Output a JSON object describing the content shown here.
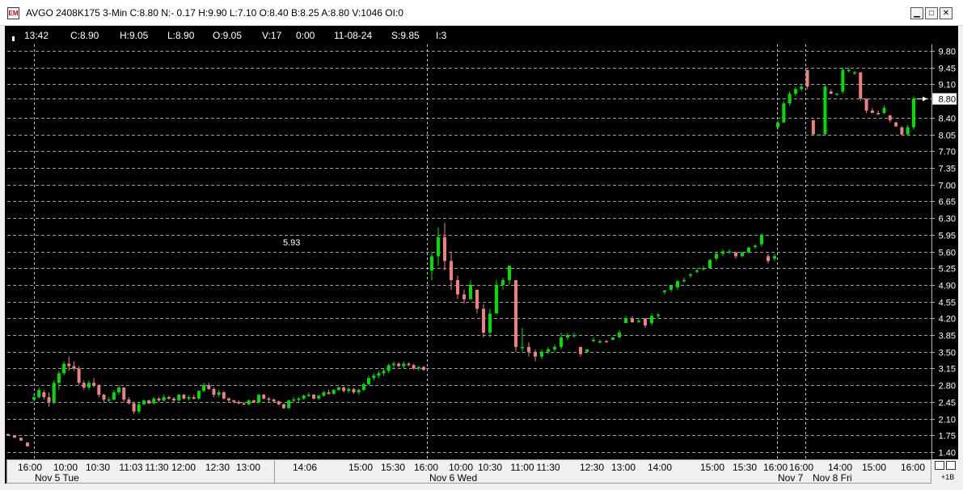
{
  "window": {
    "title": "AVGO 2408K175 3-Min C:8.80 N:- 0.17 H:9.90 L:7.10 O:8.40 B:8.25 A:8.80 V:1046 OI:0",
    "icon": "chart-app-icon",
    "buttons": {
      "minimize": "▁",
      "maximize": "□",
      "close": "✕"
    }
  },
  "infobar": {
    "time": "13:42",
    "close": "C:8.90",
    "high": "H:9.05",
    "low": "L:8.90",
    "open": "O:9.05",
    "volume": "V:17",
    "v2": "0:00",
    "date": "11-08-24",
    "s": "S:9.85",
    "i": "I:3"
  },
  "annotation_label": "5.93",
  "current_price_label": "8.80",
  "corner_label": "+1B",
  "colors": {
    "up": "#00e000",
    "down": "#f08080",
    "grid": "#a0a0a0",
    "background": "#000000"
  },
  "chart_data": {
    "type": "candlestick",
    "ylim": [
      1.4,
      9.8
    ],
    "y_ticks": [
      "9.80",
      "9.45",
      "9.10",
      "8.80",
      "8.40",
      "8.05",
      "7.70",
      "7.35",
      "7.00",
      "6.65",
      "6.30",
      "5.95",
      "5.60",
      "5.25",
      "4.90",
      "4.55",
      "4.20",
      "3.85",
      "3.50",
      "3.15",
      "2.80",
      "2.45",
      "2.10",
      "1.75",
      "1.40"
    ],
    "grid": true,
    "x_ticks": [
      "16:00",
      "10:00",
      "10:30",
      "11:03",
      "11:30",
      "12:00",
      "12:30",
      "13:00",
      "14:06",
      "15:00",
      "15:30",
      "16:00",
      "10:00",
      "10:30",
      "11:00",
      "11:30",
      "12:30",
      "13:00",
      "14:00",
      "15:00",
      "15:30",
      "16:00",
      "16:00",
      "14:00",
      "15:00",
      "16:00"
    ],
    "date_labels": [
      "Nov 5 Tue",
      "Nov 6 Wed",
      "Nov 7",
      "Nov 8 Fri"
    ],
    "series": [
      {
        "values": [
          [
            1.78,
            1.78,
            1.74,
            1.74
          ],
          [
            1.74,
            1.74,
            1.7,
            1.7
          ],
          [
            1.7,
            1.7,
            1.64,
            1.64
          ],
          [
            1.6,
            1.6,
            1.52,
            1.52
          ]
        ]
      },
      {
        "values": [
          [
            2.5,
            2.62,
            2.45,
            2.55
          ],
          [
            2.55,
            2.75,
            2.52,
            2.7
          ],
          [
            2.65,
            2.7,
            2.5,
            2.55
          ],
          [
            2.55,
            2.65,
            2.35,
            2.45
          ],
          [
            2.45,
            2.9,
            2.4,
            2.85
          ],
          [
            2.85,
            3.1,
            2.7,
            3.05
          ],
          [
            3.05,
            3.3,
            3.0,
            3.25
          ],
          [
            3.25,
            3.4,
            3.1,
            3.2
          ],
          [
            3.2,
            3.3,
            3.1,
            3.15
          ],
          [
            3.15,
            3.2,
            2.8,
            2.85
          ],
          [
            2.85,
            2.9,
            2.7,
            2.75
          ],
          [
            2.75,
            2.9,
            2.7,
            2.85
          ],
          [
            2.85,
            2.95,
            2.75,
            2.8
          ],
          [
            2.8,
            2.82,
            2.55,
            2.6
          ],
          [
            2.6,
            2.62,
            2.45,
            2.5
          ],
          [
            2.5,
            2.55,
            2.45,
            2.5
          ],
          [
            2.5,
            2.7,
            2.48,
            2.65
          ],
          [
            2.65,
            2.8,
            2.6,
            2.75
          ],
          [
            2.75,
            2.75,
            2.45,
            2.5
          ],
          [
            2.5,
            2.55,
            2.4,
            2.42
          ],
          [
            2.42,
            2.45,
            2.2,
            2.25
          ],
          [
            2.25,
            2.45,
            2.2,
            2.4
          ],
          [
            2.4,
            2.5,
            2.38,
            2.48
          ],
          [
            2.48,
            2.5,
            2.4,
            2.42
          ],
          [
            2.42,
            2.55,
            2.4,
            2.52
          ],
          [
            2.52,
            2.55,
            2.45,
            2.48
          ],
          [
            2.48,
            2.6,
            2.45,
            2.55
          ],
          [
            2.55,
            2.58,
            2.5,
            2.52
          ],
          [
            2.52,
            2.55,
            2.45,
            2.48
          ],
          [
            2.48,
            2.62,
            2.46,
            2.6
          ],
          [
            2.6,
            2.62,
            2.5,
            2.52
          ],
          [
            2.52,
            2.58,
            2.48,
            2.55
          ],
          [
            2.55,
            2.6,
            2.5,
            2.52
          ],
          [
            2.52,
            2.7,
            2.5,
            2.68
          ],
          [
            2.68,
            2.85,
            2.65,
            2.8
          ],
          [
            2.8,
            2.85,
            2.7,
            2.72
          ],
          [
            2.72,
            2.75,
            2.55,
            2.6
          ],
          [
            2.6,
            2.7,
            2.55,
            2.65
          ],
          [
            2.65,
            2.68,
            2.5,
            2.52
          ],
          [
            2.52,
            2.55,
            2.45,
            2.48
          ],
          [
            2.48,
            2.5,
            2.42,
            2.45
          ],
          [
            2.45,
            2.48,
            2.4,
            2.42
          ],
          [
            2.42,
            2.45,
            2.38,
            2.4
          ],
          [
            2.4,
            2.5,
            2.38,
            2.48
          ],
          [
            2.48,
            2.5,
            2.42,
            2.44
          ],
          [
            2.44,
            2.62,
            2.42,
            2.6
          ],
          [
            2.6,
            2.62,
            2.5,
            2.52
          ],
          [
            2.52,
            2.55,
            2.45,
            2.5
          ],
          [
            2.5,
            2.52,
            2.44,
            2.46
          ],
          [
            2.46,
            2.48,
            2.38,
            2.4
          ],
          [
            2.4,
            2.42,
            2.3,
            2.32
          ],
          [
            2.32,
            2.5,
            2.3,
            2.48
          ],
          [
            2.48,
            2.55,
            2.45,
            2.5
          ],
          [
            2.5,
            2.55,
            2.45,
            2.52
          ],
          [
            2.52,
            2.6,
            2.5,
            2.58
          ],
          [
            2.58,
            2.65,
            2.55,
            2.6
          ],
          [
            2.6,
            2.62,
            2.5,
            2.52
          ],
          [
            2.52,
            2.6,
            2.5,
            2.58
          ],
          [
            2.58,
            2.68,
            2.56,
            2.65
          ],
          [
            2.65,
            2.7,
            2.6,
            2.62
          ],
          [
            2.62,
            2.72,
            2.6,
            2.7
          ],
          [
            2.7,
            2.78,
            2.68,
            2.75
          ],
          [
            2.75,
            2.78,
            2.65,
            2.68
          ],
          [
            2.68,
            2.75,
            2.64,
            2.72
          ],
          [
            2.72,
            2.74,
            2.62,
            2.65
          ],
          [
            2.65,
            2.72,
            2.6,
            2.7
          ],
          [
            2.7,
            2.85,
            2.68,
            2.82
          ],
          [
            2.82,
            3.0,
            2.8,
            2.95
          ],
          [
            2.95,
            3.05,
            2.9,
            3.0
          ],
          [
            3.0,
            3.1,
            2.95,
            3.05
          ],
          [
            3.05,
            3.15,
            3.0,
            3.1
          ],
          [
            3.1,
            3.25,
            3.05,
            3.22
          ],
          [
            3.22,
            3.3,
            3.15,
            3.25
          ],
          [
            3.25,
            3.28,
            3.18,
            3.2
          ],
          [
            3.2,
            3.3,
            3.15,
            3.25
          ],
          [
            3.25,
            3.28,
            3.2,
            3.22
          ],
          [
            3.22,
            3.25,
            3.12,
            3.15
          ],
          [
            3.15,
            3.2,
            3.1,
            3.18
          ],
          [
            3.18,
            3.2,
            3.1,
            3.12
          ]
        ]
      },
      {
        "values": [
          [
            5.2,
            5.6,
            5.0,
            5.5
          ],
          [
            5.5,
            6.1,
            5.3,
            5.9
          ],
          [
            5.9,
            6.2,
            5.2,
            5.4
          ],
          [
            5.4,
            5.6,
            4.8,
            5.0
          ],
          [
            5.0,
            5.1,
            4.6,
            4.7
          ],
          [
            4.7,
            4.8,
            4.5,
            4.6
          ],
          [
            4.6,
            5.0,
            4.6,
            4.9
          ],
          [
            4.8,
            4.8,
            4.3,
            4.4
          ],
          [
            4.4,
            4.5,
            3.8,
            3.9
          ],
          [
            3.9,
            4.4,
            3.8,
            4.3
          ],
          [
            4.3,
            5.0,
            4.3,
            4.9
          ],
          [
            4.9,
            5.05,
            4.8,
            5.0
          ],
          [
            5.0,
            5.3,
            4.9,
            5.3
          ],
          [
            5.0,
            5.0,
            3.5,
            3.6
          ],
          [
            3.6,
            4.0,
            3.5,
            3.6
          ],
          [
            3.6,
            3.7,
            3.4,
            3.5
          ],
          [
            3.5,
            3.55,
            3.3,
            3.4
          ],
          [
            3.4,
            3.55,
            3.35,
            3.5
          ],
          [
            3.5,
            3.6,
            3.45,
            3.55
          ],
          [
            3.55,
            3.65,
            3.5,
            3.6
          ],
          [
            3.6,
            3.9,
            3.55,
            3.8
          ],
          [
            3.8,
            3.9,
            3.75,
            3.85
          ],
          [
            3.85,
            3.9,
            3.8,
            3.85
          ],
          [
            3.6,
            3.6,
            3.4,
            3.45
          ],
          [
            3.5,
            3.55,
            3.5,
            3.55
          ],
          [
            3.75,
            3.8,
            3.7,
            3.75
          ],
          [
            3.7,
            3.75,
            3.68,
            3.72
          ],
          [
            3.72,
            3.75,
            3.7,
            3.7
          ],
          [
            3.75,
            3.8,
            3.75,
            3.8
          ],
          [
            3.8,
            3.95,
            3.8,
            3.9
          ],
          [
            4.1,
            4.25,
            4.1,
            4.2
          ],
          [
            4.2,
            4.25,
            4.1,
            4.12
          ],
          [
            4.15,
            4.2,
            4.1,
            4.15
          ],
          [
            4.2,
            4.2,
            4.0,
            4.05
          ],
          [
            4.1,
            4.3,
            4.05,
            4.25
          ],
          [
            4.25,
            4.3,
            4.2,
            4.28
          ],
          [
            4.75,
            4.8,
            4.7,
            4.78
          ],
          [
            4.8,
            4.9,
            4.75,
            4.88
          ],
          [
            4.85,
            5.0,
            4.8,
            4.98
          ],
          [
            5.0,
            5.05,
            4.95,
            5.0
          ],
          [
            5.1,
            5.15,
            5.05,
            5.12
          ],
          [
            5.2,
            5.25,
            5.15,
            5.2
          ],
          [
            5.25,
            5.3,
            5.2,
            5.25
          ],
          [
            5.25,
            5.45,
            5.25,
            5.42
          ],
          [
            5.45,
            5.6,
            5.4,
            5.55
          ],
          [
            5.55,
            5.65,
            5.5,
            5.6
          ],
          [
            5.6,
            5.65,
            5.55,
            5.6
          ],
          [
            5.58,
            5.6,
            5.45,
            5.5
          ],
          [
            5.5,
            5.6,
            5.48,
            5.58
          ],
          [
            5.58,
            5.7,
            5.55,
            5.68
          ],
          [
            5.7,
            5.75,
            5.65,
            5.72
          ],
          [
            5.75,
            5.98,
            5.7,
            5.95
          ],
          [
            5.5,
            5.55,
            5.35,
            5.4
          ],
          [
            5.45,
            5.55,
            5.4,
            5.5
          ]
        ]
      },
      {
        "values": [
          [
            8.2,
            8.35,
            8.15,
            8.3
          ],
          [
            8.3,
            8.75,
            8.3,
            8.7
          ],
          [
            8.7,
            8.95,
            8.65,
            8.9
          ],
          [
            8.9,
            9.05,
            8.85,
            9.0
          ],
          [
            9.0,
            9.1,
            8.95,
            9.05
          ],
          [
            9.4,
            9.4,
            9.0,
            9.05
          ],
          [
            8.35,
            8.35,
            8.05,
            8.05
          ],
          [
            8.05,
            8.05,
            8.03,
            8.05
          ],
          [
            8.05,
            9.1,
            8.05,
            9.05
          ],
          [
            8.95,
            9.0,
            8.9,
            8.9
          ],
          [
            8.9,
            8.92,
            8.88,
            8.9
          ],
          [
            8.95,
            9.45,
            8.9,
            9.4
          ],
          [
            9.4,
            9.45,
            9.35,
            9.4
          ],
          [
            9.35,
            9.38,
            9.3,
            9.35
          ],
          [
            9.35,
            9.35,
            8.75,
            8.8
          ],
          [
            8.8,
            8.8,
            8.5,
            8.55
          ],
          [
            8.55,
            8.6,
            8.5,
            8.5
          ],
          [
            8.5,
            8.55,
            8.45,
            8.48
          ],
          [
            8.5,
            8.65,
            8.48,
            8.6
          ],
          [
            8.45,
            8.45,
            8.3,
            8.35
          ],
          [
            8.3,
            8.32,
            8.2,
            8.22
          ],
          [
            8.2,
            8.22,
            8.02,
            8.05
          ],
          [
            8.05,
            8.25,
            8.03,
            8.2
          ],
          [
            8.2,
            8.85,
            8.15,
            8.8
          ]
        ]
      }
    ]
  }
}
